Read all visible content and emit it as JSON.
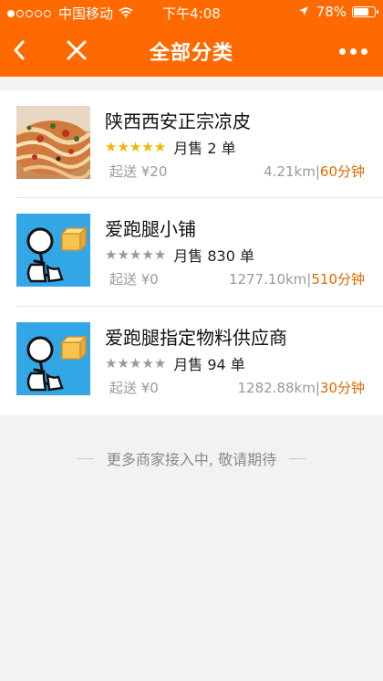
{
  "status_bar": {
    "carrier": "中国移动",
    "time": "下午4:08",
    "battery": "78%",
    "battery_level": 0.78,
    "signal_dots_filled": 1,
    "signal_dots_total": 5
  },
  "navbar": {
    "title": "全部分类",
    "back_icon": "chevron-left-icon",
    "close_icon": "close-icon",
    "more_icon": "more-dots-icon"
  },
  "stores": [
    {
      "name": "陕西西安正宗凉皮",
      "stars_filled": 5,
      "stars_total": 5,
      "sales": "月售 2 单",
      "min_order": "起送 ¥20",
      "distance": "4.21km",
      "separator": "|",
      "delivery_time": "60分钟",
      "thumb_icon": "food-photo-icon"
    },
    {
      "name": "爱跑腿小铺",
      "stars_filled": 0,
      "stars_total": 5,
      "sales": "月售 830 单",
      "min_order": "起送 ¥0",
      "distance": "1277.10km",
      "separator": "|",
      "delivery_time": "510分钟",
      "thumb_icon": "courier-logo-icon"
    },
    {
      "name": "爱跑腿指定物料供应商",
      "stars_filled": 0,
      "stars_total": 5,
      "sales": "月售 94 单",
      "min_order": "起送 ¥0",
      "distance": "1282.88km",
      "separator": "|",
      "delivery_time": "30分钟",
      "thumb_icon": "courier-logo-icon"
    }
  ],
  "footer": {
    "text": "更多商家接入中, 敬请期待"
  },
  "colors": {
    "brand": "#ff6a00",
    "star_filled": "#f5b400",
    "star_empty": "#999999",
    "eta": "#e06a00",
    "muted": "#999999"
  }
}
